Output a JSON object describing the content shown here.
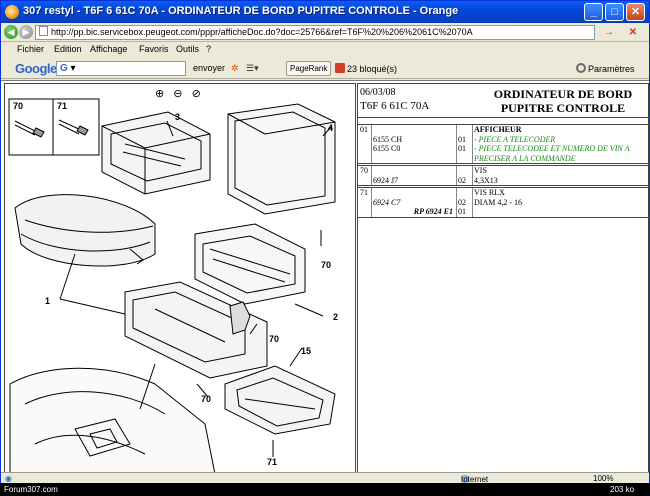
{
  "window": {
    "title": "307 restyl - T6F 6 61C 70A - ORDINATEUR DE BORD PUPITRE CONTROLE - Orange",
    "minimize": "_",
    "maximize": "□",
    "close": "✕"
  },
  "address": {
    "url": "http://pp.bic.servicebox.peugeot.com/pppr/afficheDoc.do?doc=25766&ref=T6F%20%206%2061C%2070A",
    "back_icon": "◀",
    "forward_icon": "▶",
    "go_icon": "→",
    "close_icon": "✕"
  },
  "menu": {
    "items": [
      "Fichier",
      "Edition",
      "Affichage",
      "Favoris",
      "Outils",
      "?"
    ]
  },
  "googlebar": {
    "logo": "Google",
    "search_placeholder": "G",
    "send_label": "envoyer",
    "bookmark_label": "PageRank",
    "blocked_label": "23 bloqué(s)",
    "settings_label": "Paramètres"
  },
  "drawing": {
    "zoom_in": "⊕",
    "zoom_out": "⊖",
    "zoom_reset": "⊘",
    "callouts": [
      "70",
      "71",
      "1",
      "2",
      "3",
      "4",
      "15",
      "70",
      "70",
      "70",
      "71"
    ]
  },
  "document": {
    "date": "06/03/08",
    "reference": "T6F 6 61C 70A",
    "title_line1": "ORDINATEUR DE BORD",
    "title_line2": "PUPITRE CONTROLE",
    "rows": [
      {
        "rep": "01",
        "lines": [
          {
            "ref": "",
            "qty": "",
            "desc": "AFFICHEUR",
            "style": "bold"
          },
          {
            "ref": "6155 CH",
            "qty": "01",
            "desc": "- PIECE A TELECODER",
            "style": "green"
          },
          {
            "ref": "6155 C0",
            "qty": "01",
            "desc": "- PIECE TELECODEE ET NUMERO DE VIN A",
            "style": "green"
          },
          {
            "ref": "",
            "qty": "",
            "desc": "PRECISER A LA COMMANDE",
            "style": "green"
          }
        ]
      },
      {
        "rep": "70",
        "lines": [
          {
            "ref": "",
            "qty": "",
            "desc": "VIS",
            "style": ""
          },
          {
            "ref": "6924 J7",
            "qty": "02",
            "desc": "4,3X13",
            "style": ""
          }
        ]
      },
      {
        "rep": "71",
        "lines": [
          {
            "ref": "",
            "qty": "",
            "desc": "VIS RLX",
            "style": ""
          },
          {
            "ref": "6924 C7",
            "qty": "02",
            "desc": "DIAM 4,2 - 16",
            "style": "italic"
          },
          {
            "ref": "RP 6924 E1",
            "qty": "01",
            "desc": "",
            "style": "bold"
          }
        ]
      }
    ]
  },
  "status": {
    "internet": "Internet",
    "zoom": "100%"
  },
  "watermark": {
    "site": "Forum307.com",
    "size": "203 ko"
  }
}
